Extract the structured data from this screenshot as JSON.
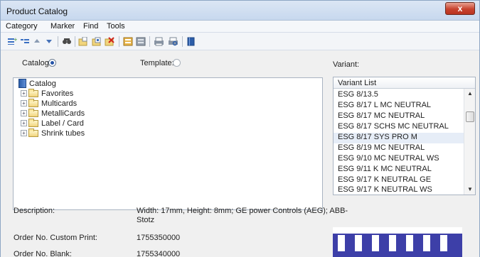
{
  "window": {
    "title": "Product Catalog",
    "close_label": "x"
  },
  "menu": [
    "Category",
    "Marker",
    "Find",
    "Tools"
  ],
  "toolbar_icons": [
    "add-row-icon",
    "indent-icon",
    "move-up-icon",
    "move-down-icon",
    "find-icon",
    "new-document-icon",
    "copy-document-icon",
    "delete-document-icon",
    "export-icon",
    "import-icon",
    "print-icon",
    "print-preview-icon",
    "book-icon"
  ],
  "selection": {
    "catalog_label": "Catalog:",
    "template_label": "Template:",
    "catalog_selected": true,
    "variant_label": "Variant:"
  },
  "tree": {
    "root": "Catalog",
    "children": [
      "Favorites",
      "Multicards",
      "MetalliCards",
      "Label / Card",
      "Shrink tubes"
    ]
  },
  "variant_list": {
    "header": "Variant List",
    "items": [
      "ESG 8/13.5",
      "ESG 8/17 L MC NEUTRAL",
      "ESG 8/17 MC NEUTRAL",
      "ESG 8/17 SCHS MC NEUTRAL",
      "ESG 8/17 SYS PRO M",
      "ESG 8/19 MC NEUTRAL",
      "ESG 9/10 MC NEUTRAL WS",
      "ESG 9/11 K MC NEUTRAL",
      "ESG 9/17 K NEUTRAL GE",
      "ESG 9/17 K NEUTRAL WS"
    ],
    "selected_index": 4
  },
  "details": {
    "description_label": "Description:",
    "description_value_line1": "Width: 17mm, Height: 8mm; GE power Controls (AEG); ABB-",
    "description_value_line2": "Stotz",
    "order_custom_label": "Order No. Custom Print:",
    "order_custom_value": "1755350000",
    "order_blank_label": "Order No. Blank:",
    "order_blank_value": "1755340000"
  },
  "colors": {
    "accent": "#2453a7",
    "preview_marker": "#3d3fa8",
    "close_button": "#c8432e"
  }
}
